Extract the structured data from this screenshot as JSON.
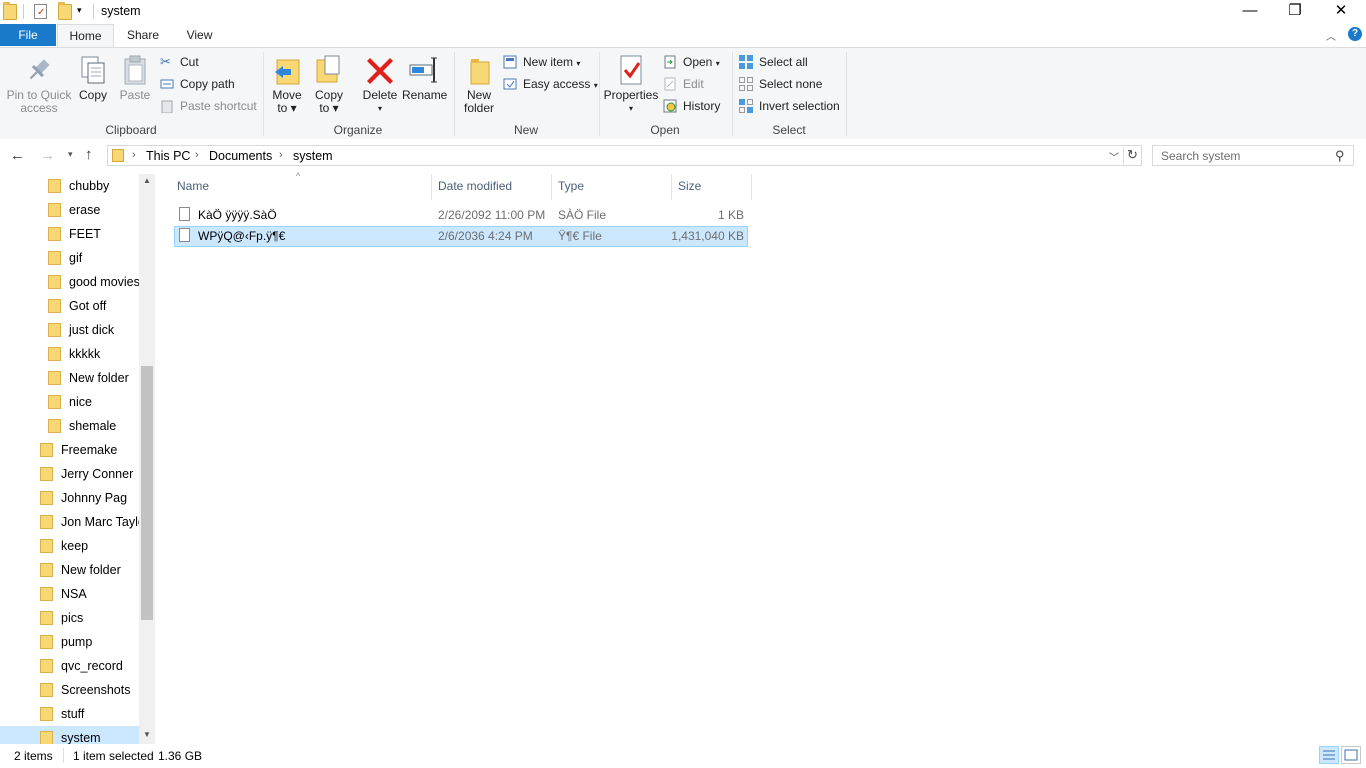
{
  "window": {
    "title": "system",
    "minimize_glyph": "—",
    "restore_glyph": "❐",
    "close_glyph": "✕"
  },
  "ribbon": {
    "tabs": [
      "File",
      "Home",
      "Share",
      "View"
    ],
    "clipboard": {
      "label": "Clipboard",
      "pin_line1": "Pin to Quick",
      "pin_line2": "access",
      "copy": "Copy",
      "paste": "Paste",
      "cut": "Cut",
      "copy_path": "Copy path",
      "paste_shortcut": "Paste shortcut"
    },
    "organize": {
      "label": "Organize",
      "move_line1": "Move",
      "move_line2": "to",
      "copy_line1": "Copy",
      "copy_line2": "to",
      "delete": "Delete",
      "rename": "Rename"
    },
    "new": {
      "label": "New",
      "new_folder_line1": "New",
      "new_folder_line2": "folder",
      "new_item": "New item",
      "easy_access": "Easy access"
    },
    "open": {
      "label": "Open",
      "properties": "Properties",
      "open": "Open",
      "edit": "Edit",
      "history": "History"
    },
    "select": {
      "label": "Select",
      "select_all": "Select all",
      "select_none": "Select none",
      "invert_selection": "Invert selection"
    }
  },
  "address": {
    "crumbs": [
      "This PC",
      "Documents",
      "system"
    ],
    "search_placeholder": "Search system"
  },
  "nav": {
    "items": [
      "chubby",
      "erase",
      "FEET",
      "gif",
      "good movies",
      "Got off",
      "just dick",
      "kkkkk",
      "New folder",
      "nice",
      "shemale",
      "Freemake",
      "Jerry Conner",
      "Johnny Pag",
      "Jon Marc Taylo",
      "keep",
      "New folder",
      "NSA",
      "pics",
      "pump",
      "qvc_record",
      "Screenshots",
      "stuff",
      "system"
    ]
  },
  "files": {
    "columns": [
      "Name",
      "Date modified",
      "Type",
      "Size"
    ],
    "rows": [
      {
        "name": "KàÖ ÿÿÿÿ.SàÖ",
        "date": "2/26/2092 11:00 PM",
        "type": "SÀÖ File",
        "size": "1 KB"
      },
      {
        "name": "WPÿQ@‹Fp.ÿ¶€",
        "date": "2/6/2036 4:24 PM",
        "type": "Ÿ¶€ File",
        "size": "1,431,040 KB"
      }
    ]
  },
  "status": {
    "items": "2 items",
    "selected": "1 item selected",
    "size": "1.36 GB"
  },
  "colors": {
    "accent": "#1979ca",
    "selection": "#cce8ff",
    "folder": "#f8d775"
  }
}
